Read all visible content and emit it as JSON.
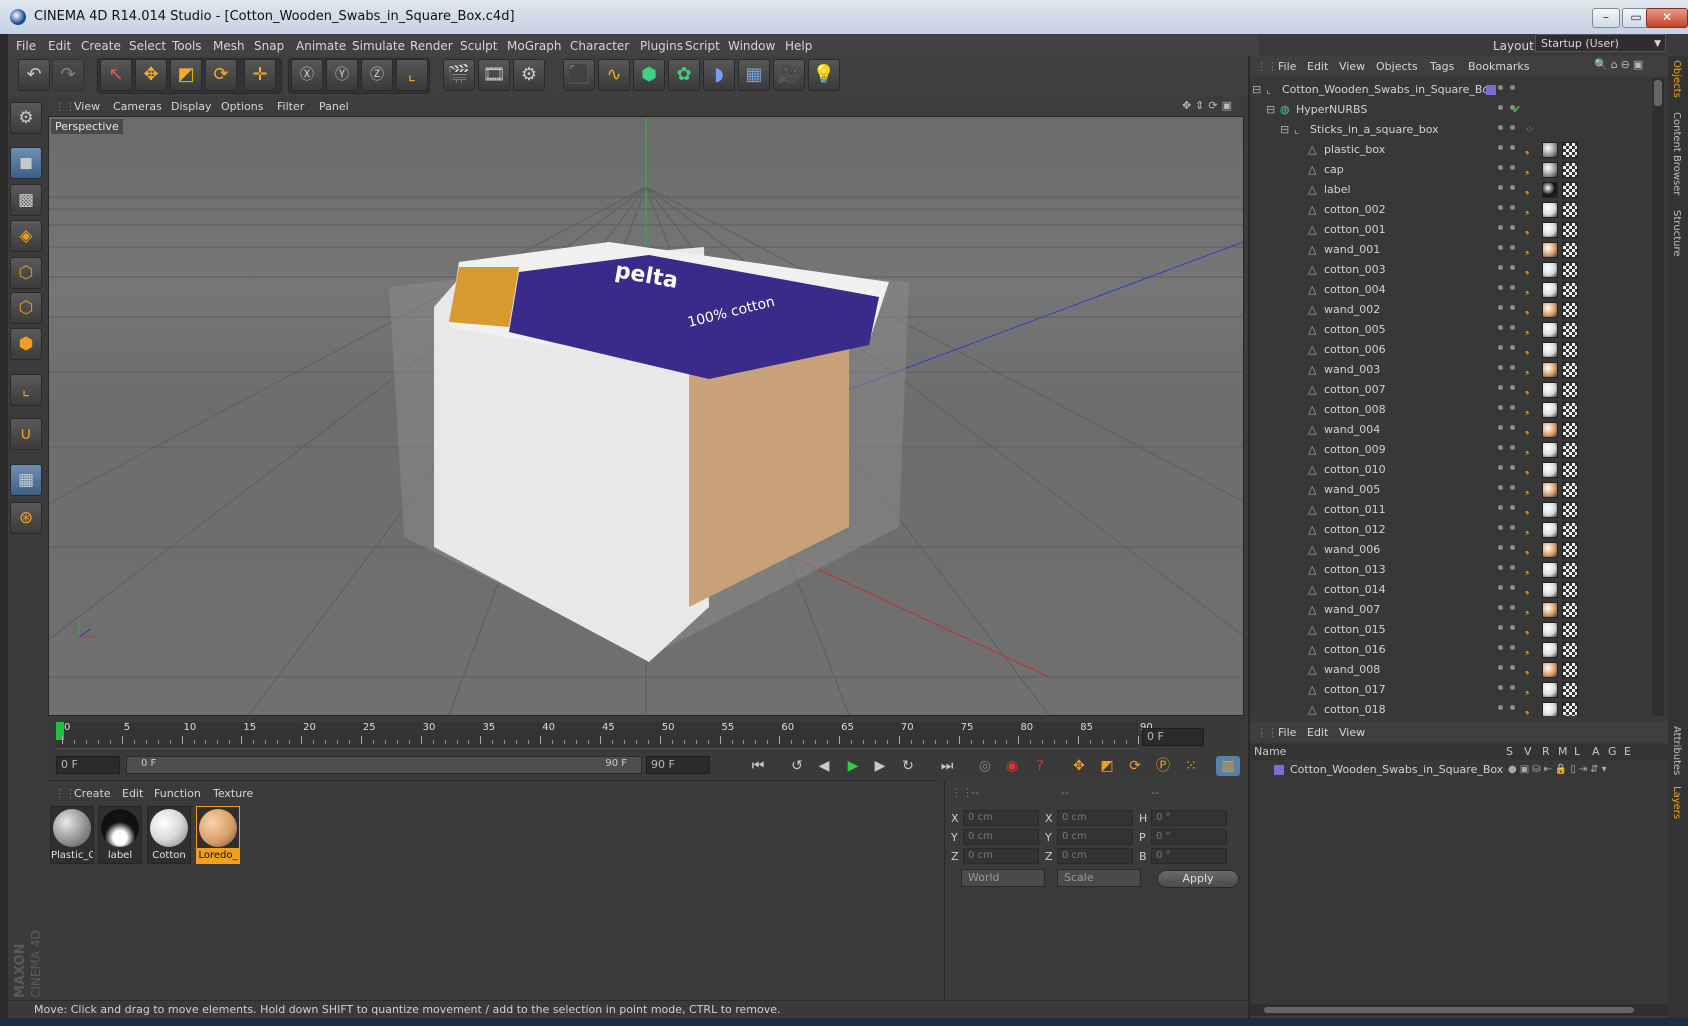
{
  "window": {
    "title": "CINEMA 4D R14.014 Studio - [Cotton_Wooden_Swabs_in_Square_Box.c4d]",
    "min": "–",
    "max": "▭",
    "close": "✕"
  },
  "menubar": [
    "File",
    "Edit",
    "Create",
    "Select",
    "Tools",
    "Mesh",
    "Snap",
    "Animate",
    "Simulate",
    "Render",
    "Sculpt",
    "MoGraph",
    "Character",
    "Plugins",
    "Script",
    "Window",
    "Help"
  ],
  "layout": {
    "label": "Layout:",
    "value": "Startup (User)"
  },
  "viewport": {
    "menu": [
      "View",
      "Cameras",
      "Display",
      "Options",
      "Filter",
      "Panel"
    ],
    "label": "Perspective",
    "box_brand": "pelta",
    "box_text": "100% cotton"
  },
  "timeline": {
    "ticks": [
      "0",
      "5",
      "10",
      "15",
      "20",
      "25",
      "30",
      "35",
      "40",
      "45",
      "50",
      "55",
      "60",
      "65",
      "70",
      "75",
      "80",
      "85",
      "90"
    ],
    "current_frame": "0 F",
    "start_field": "0 F",
    "range_start": "0 F",
    "range_end": "90 F",
    "end_field": "90 F"
  },
  "materials": {
    "menu": [
      "Create",
      "Edit",
      "Function",
      "Texture"
    ],
    "items": [
      {
        "name": "Plastic_C",
        "color": "#9c9c9c"
      },
      {
        "name": "label",
        "color": "#111111"
      },
      {
        "name": "Cotton",
        "color": "#e0e0e0"
      },
      {
        "name": "Loredo_",
        "color": "#d9a06a"
      }
    ]
  },
  "coords": {
    "headers": [
      "--",
      "--",
      "--"
    ],
    "rows": [
      {
        "a": "X",
        "av": "0 cm",
        "b": "X",
        "bv": "0 cm",
        "c": "H",
        "cv": "0 °"
      },
      {
        "a": "Y",
        "av": "0 cm",
        "b": "Y",
        "bv": "0 cm",
        "c": "P",
        "cv": "0 °"
      },
      {
        "a": "Z",
        "av": "0 cm",
        "b": "Z",
        "bv": "0 cm",
        "c": "B",
        "cv": "0 °"
      }
    ],
    "mode1": "World",
    "mode2": "Scale",
    "apply": "Apply"
  },
  "status": "Move: Click and drag to move elements. Hold down SHIFT to quantize movement / add to the selection in point mode, CTRL to remove.",
  "objects": {
    "menu": [
      "File",
      "Edit",
      "View",
      "Objects",
      "Tags",
      "Bookmarks"
    ],
    "root": "Cotton_Wooden_Swabs_in_Square_Box",
    "hypernurbs": "HyperNURBS",
    "group": "Sticks_in_a_square_box",
    "children": [
      "plastic_box",
      "cap",
      "label",
      "cotton_002",
      "cotton_001",
      "wand_001",
      "cotton_003",
      "cotton_004",
      "wand_002",
      "cotton_005",
      "cotton_006",
      "wand_003",
      "cotton_007",
      "cotton_008",
      "wand_004",
      "cotton_009",
      "cotton_010",
      "wand_005",
      "cotton_011",
      "cotton_012",
      "wand_006",
      "cotton_013",
      "cotton_014",
      "wand_007",
      "cotton_015",
      "cotton_016",
      "wand_008",
      "cotton_017",
      "cotton_018"
    ]
  },
  "layers": {
    "menu": [
      "File",
      "Edit",
      "View"
    ],
    "header": {
      "name": "Name",
      "cols": [
        "S",
        "V",
        "R",
        "M",
        "L",
        "A",
        "G",
        "E"
      ]
    },
    "items": [
      "Cotton_Wooden_Swabs_in_Square_Box"
    ]
  },
  "side_tabs": [
    "Objects",
    "Content Browser",
    "Structure",
    "Attributes",
    "Layers"
  ],
  "brand": {
    "maxon": "MAXON",
    "cinema": "CINEMA 4D"
  },
  "colors": {
    "accent": "#f0a020",
    "selection": "#5a7fa8",
    "layer": "#7a6fd0"
  }
}
